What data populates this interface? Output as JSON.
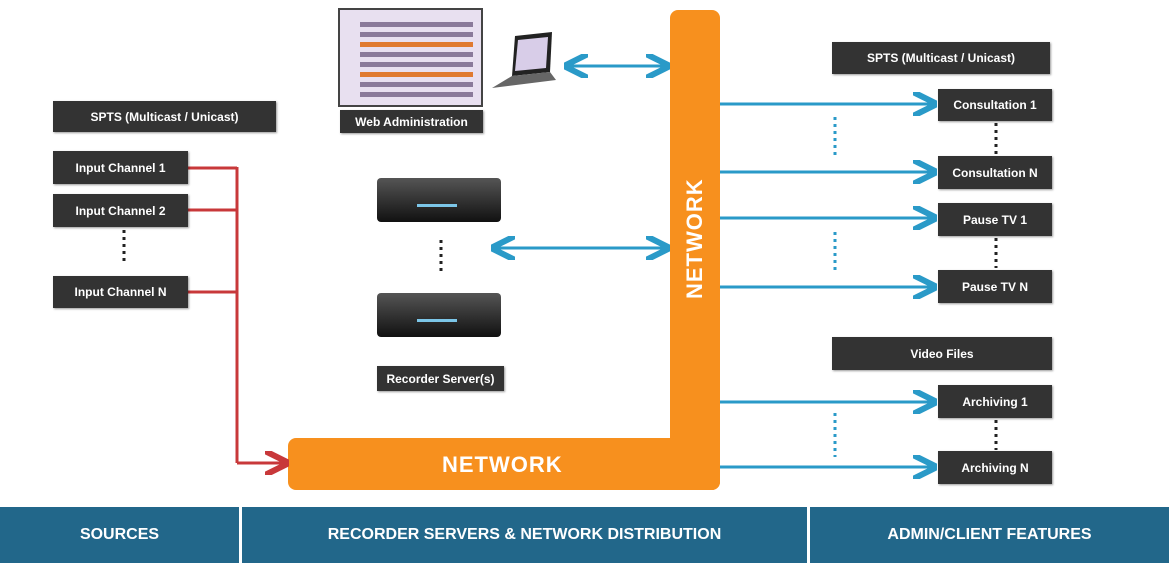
{
  "sources": {
    "header": "SPTS (Multicast / Unicast)",
    "inputs": [
      "Input Channel 1",
      "Input Channel 2",
      "Input Channel N"
    ]
  },
  "center": {
    "web_admin": "Web Administration",
    "recorder": "Recorder Server(s)",
    "network_horizontal": "NETWORK",
    "network_vertical": "NETWORK"
  },
  "outputs": {
    "spts_header": "SPTS (Multicast / Unicast)",
    "consultation": [
      "Consultation 1",
      "Consultation N"
    ],
    "pause": [
      "Pause TV 1",
      "Pause TV N"
    ],
    "files_header": "Video Files",
    "archiving": [
      "Archiving 1",
      "Archiving N"
    ]
  },
  "footer": [
    "SOURCES",
    "RECORDER SERVERS & NETWORK DISTRIBUTION",
    "ADMIN/CLIENT FEATURES"
  ],
  "colors": {
    "network": "#f7901e",
    "source_line": "#c8383a",
    "distribution_line": "#2a9ac8",
    "footer": "#22678a",
    "box": "#333333"
  }
}
